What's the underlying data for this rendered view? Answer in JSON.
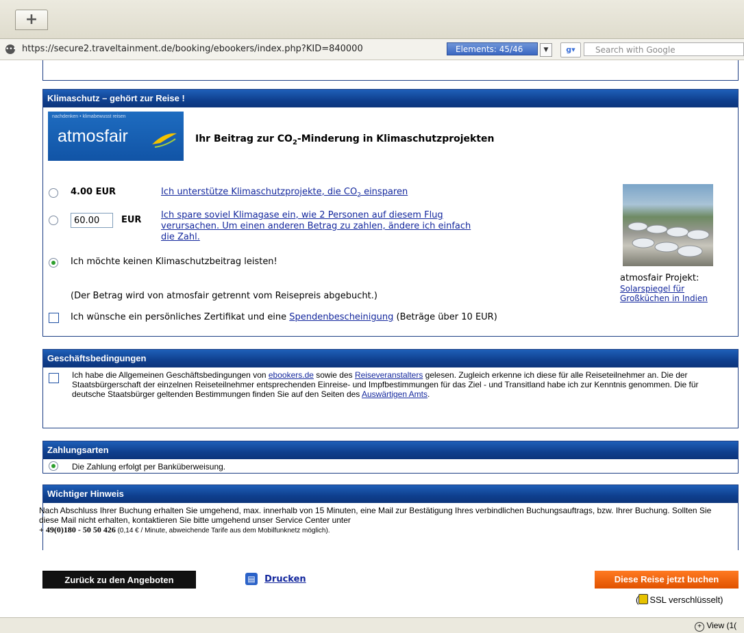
{
  "browser": {
    "new_tab_label": "+",
    "url": "https://secure2.traveltainment.de/booking/ebookers/index.php?KID=840000",
    "elements_label": "Elements:  45/46",
    "search_placeholder": "Search with Google",
    "status_view": "View (1("
  },
  "klima": {
    "header": "Klimaschutz – gehört zur Reise !",
    "logo_small": "nachdenken • klimabewusst reisen",
    "logo_name": "atmosfair",
    "headline_pre": "Ihr Beitrag zur CO",
    "headline_sub": "2",
    "headline_post": "-Minderung in Klimaschutzprojekten",
    "option1_amount": "4.00 EUR",
    "option1_link_pre": "Ich unterstütze Klimaschutzprojekte, die CO",
    "option1_link_sub": "2",
    "option1_link_post": " einsparen",
    "option2_value": "60.00",
    "option2_currency": "EUR",
    "option2_link_line1": "Ich spare soviel Klimagase ein, wie 2 Personen auf diesem Flug",
    "option2_link_line2": "verursachen. Um einen anderen Betrag zu zahlen, ändere ich einfach",
    "option2_link_line3": "die Zahl.",
    "option3_label": "Ich möchte keinen Klimaschutzbeitrag leisten!",
    "note": "(Der Betrag wird von atmosfair getrennt vom Reisepreis abgebucht.)",
    "cert_pre": "Ich wünsche ein persönliches Zertifikat und eine ",
    "cert_link": "Spendenbescheinigung",
    "cert_post": " (Beträge über 10 EUR)",
    "project_label": "atmosfair Projekt:",
    "project_link1": "Solarspiegel für",
    "project_link2": "Großküchen in Indien"
  },
  "agb": {
    "header": "Geschäftsbedingungen",
    "t1": "Ich habe die Allgemeinen Geschäftsbedingungen von ",
    "link1": "ebookers.de",
    "t2": " sowie des ",
    "link2": "Reiseveranstalters",
    "t3": " gelesen. Zugleich erkenne ich diese für alle Reiseteilnehmer an. Die der Staatsbürgerschaft der einzelnen Reiseteilnehmer entsprechenden Einreise- und Impfbestimmungen für das Ziel - und Transitland habe ich zur Kenntnis genommen. Die für deutsche Staatsbürger geltenden Bestimmungen finden Sie auf den Seiten des ",
    "link3": "Auswärtigen Amts",
    "t4": "."
  },
  "payment": {
    "header": "Zahlungsarten",
    "option": "Die Zahlung erfolgt per Banküberweisung."
  },
  "notice": {
    "header": "Wichtiger Hinweis",
    "text1": "Nach Abschluss Ihrer Buchung erhalten Sie umgehend, max. innerhalb von 15 Minuten, eine Mail zur Bestätigung Ihres verbindlichen Buchungsauftrags, bzw. Ihrer Buchung. Sollten Sie diese Mail nicht erhalten, kontaktieren Sie bitte umgehend unser Service Center unter",
    "phone": "+ 49(0)180 - 50 50 426",
    "rate": " (0,14 € / Minute, abweichende Tarife aus dem Mobilfunknetz möglich)."
  },
  "actions": {
    "back": "Zurück zu den Angeboten",
    "print": "Drucken",
    "book": "Diese Reise jetzt buchen",
    "ssl_pre": "(",
    "ssl": "SSL verschlüsselt)"
  }
}
